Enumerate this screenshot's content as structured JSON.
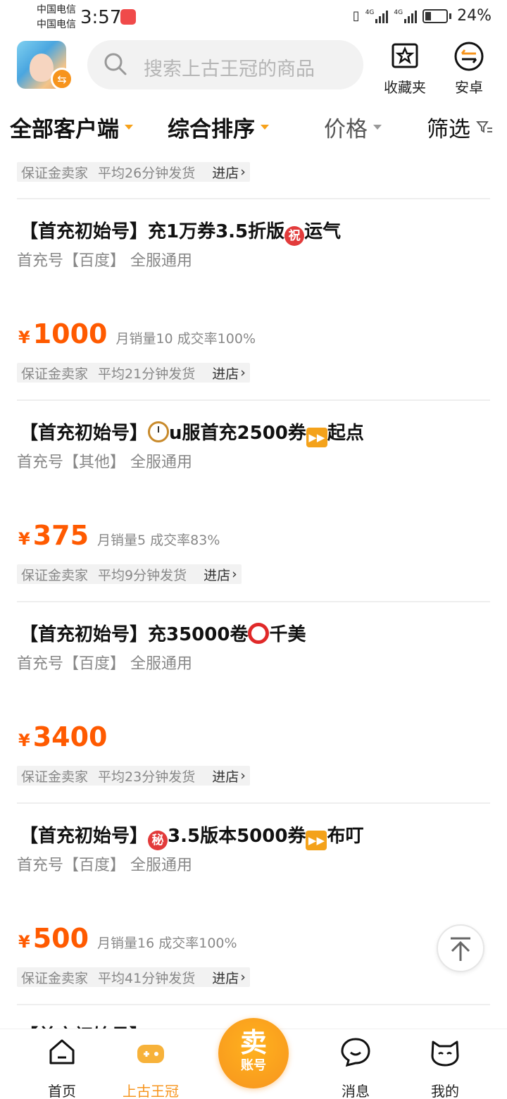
{
  "status_bar": {
    "carrier1": "中国电信",
    "carrier2": "中国电信",
    "time": "3:57",
    "battery": "24%",
    "network1": "4G",
    "network2": "4G"
  },
  "header": {
    "search_placeholder": "搜索上古王冠的商品",
    "favorites_label": "收藏夹",
    "platform_label": "安卓"
  },
  "filters": {
    "client": "全部客户端",
    "sort": "综合排序",
    "price": "价格",
    "filter": "筛选"
  },
  "listings": [
    {
      "title": "",
      "subtitle": "",
      "price": "",
      "stats": "",
      "seller_tag": "保证金卖家",
      "delivery": "平均26分钟发货",
      "enter_store": "进店"
    },
    {
      "title_prefix": "【首充初始号】充1万券3.5折版",
      "title_badge": "祝",
      "title_suffix": "运气",
      "subtitle": "首充号【百度】 全服通用",
      "currency": "¥",
      "price": "1000",
      "stats": "月销量10 成交率100%",
      "seller_tag": "保证金卖家",
      "delivery": "平均21分钟发货",
      "enter_store": "进店"
    },
    {
      "title_prefix": "【首充初始号】",
      "title_mid": "u服首充2500券",
      "title_suffix": "起点",
      "subtitle": "首充号【其他】 全服通用",
      "currency": "¥",
      "price": "375",
      "stats": "月销量5 成交率83%",
      "seller_tag": "保证金卖家",
      "delivery": "平均9分钟发货",
      "enter_store": "进店"
    },
    {
      "title_prefix": "【首充初始号】充35000卷",
      "title_suffix": "千美",
      "subtitle": "首充号【百度】 全服通用",
      "currency": "¥",
      "price": "3400",
      "stats": "",
      "seller_tag": "保证金卖家",
      "delivery": "平均23分钟发货",
      "enter_store": "进店"
    },
    {
      "title_prefix": "【首充初始号】",
      "title_badge": "秘",
      "title_mid": "3.5版本5000券",
      "title_suffix": "布叮",
      "subtitle": "首充号【百度】 全服通用",
      "currency": "¥",
      "price": "500",
      "stats": "月销量16 成交率100%",
      "seller_tag": "保证金卖家",
      "delivery": "平均41分钟发货",
      "enter_store": "进店"
    }
  ],
  "partial_title": "【首充初始号】",
  "tabbar": {
    "home": "首页",
    "game": "上古王冠",
    "sell_top": "卖",
    "sell_bottom": "账号",
    "messages": "消息",
    "mine": "我的"
  },
  "colors": {
    "accent": "#f7941d",
    "price": "#ff5a00"
  }
}
